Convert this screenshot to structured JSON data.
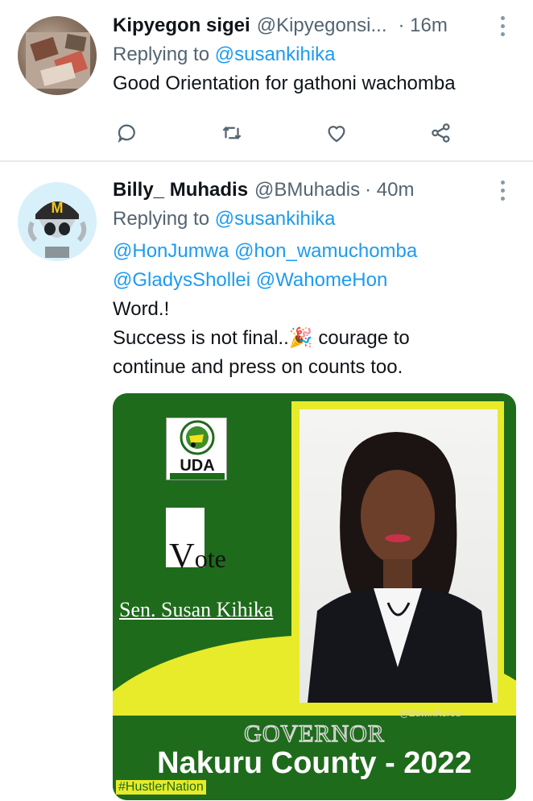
{
  "tweets": [
    {
      "name": "Kipyegon sigei",
      "handle": "@Kipyegonsi...",
      "time": "· 16m",
      "replying_prefix": "Replying to",
      "replying_to": "@susankihika",
      "text": "Good Orientation for gathoni wachomba"
    },
    {
      "name": "Billy_ Muhadis",
      "handle": "@BMuhadis",
      "time": "· 40m",
      "replying_prefix": "Replying to",
      "replying_to": "@susankihika",
      "mentions_line1": "@HonJumwa @hon_wamuchomba",
      "mentions_line2": "@GladysShollei @WahomeHon",
      "text_line1": "Word.!",
      "text_line2": "Success is not final..🎉 courage to",
      "text_line3": "continue and press on counts too.",
      "avatar_label": "M",
      "image": {
        "party": "UDA",
        "vote_v": "V",
        "vote_rest": "ote",
        "candidate": "Sen. Susan Kihika",
        "credit": "@EdwinKereu",
        "office": "GOVERNOR",
        "county": "Nakuru County - 2022",
        "hashtag": "#HustlerNation"
      }
    }
  ],
  "icons": [
    "reply-icon",
    "retweet-icon",
    "like-icon",
    "share-icon",
    "more-icon"
  ],
  "colors": {
    "link": "#1d9bf0",
    "muted": "#536471",
    "divider": "#e6ecf0",
    "icon": "#536471",
    "poster_green": "#1f6b1c",
    "poster_yellow": "#e7eb2a"
  }
}
